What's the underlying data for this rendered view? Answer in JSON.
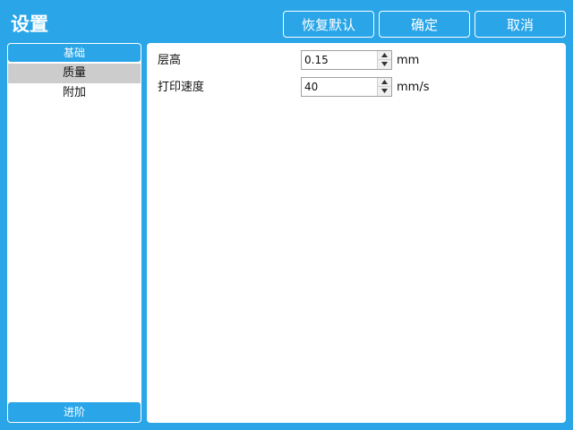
{
  "header": {
    "title": "设置",
    "restore_defaults_label": "恢复默认",
    "ok_label": "确定",
    "cancel_label": "取消"
  },
  "sidebar": {
    "header_label": "基础",
    "items": [
      {
        "label": "质量",
        "selected": true
      },
      {
        "label": "附加",
        "selected": false
      }
    ],
    "footer_label": "进阶"
  },
  "settings": {
    "layer_height": {
      "label": "层高",
      "value": "0.15",
      "unit": "mm"
    },
    "print_speed": {
      "label": "打印速度",
      "value": "40",
      "unit": "mm/s"
    }
  },
  "colors": {
    "accent": "#29a5e8",
    "panel": "#ffffff",
    "selected_item": "#cccccc"
  }
}
